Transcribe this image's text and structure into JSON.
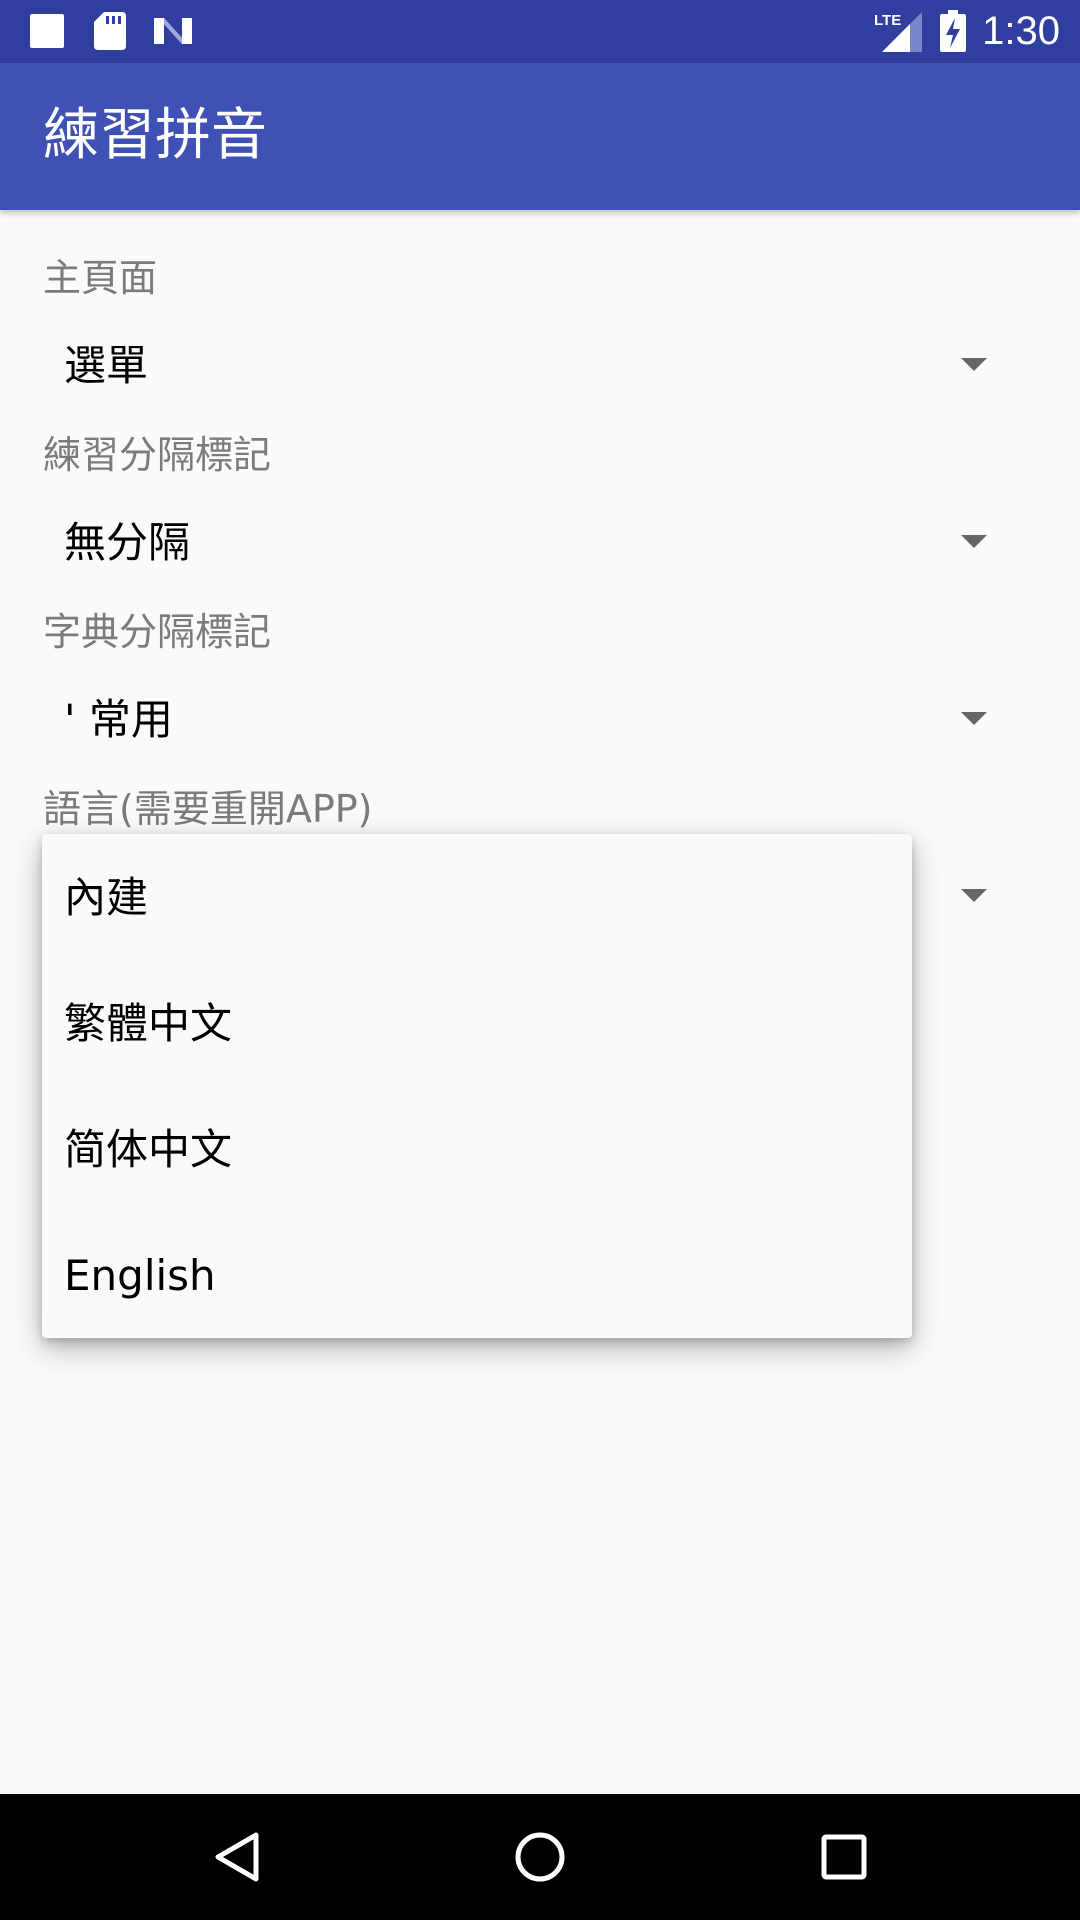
{
  "status_bar": {
    "time": "1:30",
    "network": "LTE",
    "icons": [
      "square-notification-icon",
      "sd-card-icon",
      "n-logo-icon",
      "lte-signal-icon",
      "battery-charging-icon"
    ]
  },
  "app_bar": {
    "title": "練習拼音"
  },
  "settings": [
    {
      "label": "主頁面",
      "value": "選單"
    },
    {
      "label": "練習分隔標記",
      "value": "無分隔"
    },
    {
      "label": "字典分隔標記",
      "value": "' 常用"
    },
    {
      "label": "語言(需要重開APP)",
      "value": ""
    }
  ],
  "dropdown": {
    "options": [
      "內建",
      "繁體中文",
      "简体中文",
      "English"
    ]
  },
  "nav_bar": {
    "buttons": [
      "back-icon",
      "home-icon",
      "recents-icon"
    ]
  },
  "colors": {
    "status_bar": "#303f9f",
    "app_bar": "#3f51b5",
    "background": "#fafafa"
  }
}
